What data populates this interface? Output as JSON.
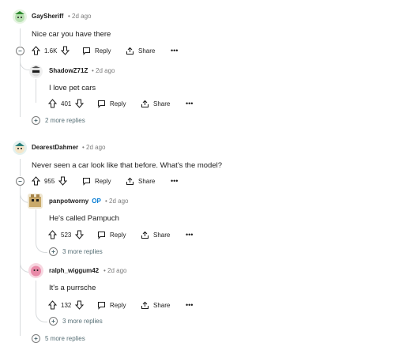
{
  "thread": {
    "comments": [
      {
        "username": "GaySheriff",
        "time": "2d ago",
        "text": "Nice car you have there",
        "votes": "1.6K",
        "reply_label": "Reply",
        "share_label": "Share",
        "replies": [
          {
            "username": "ShadowZ71Z",
            "time": "2d ago",
            "text": "I love pet cars",
            "votes": "401",
            "reply_label": "Reply",
            "share_label": "Share",
            "more_replies": "2 more replies"
          }
        ]
      },
      {
        "username": "DearestDahmer",
        "time": "2d ago",
        "text": "Never seen a car look like that before. What's the model?",
        "votes": "955",
        "reply_label": "Reply",
        "share_label": "Share",
        "more_replies": "5 more replies",
        "replies": [
          {
            "username": "panpotworny",
            "op_badge": "OP",
            "time": "2d ago",
            "text": "He's called Pampuch",
            "votes": "523",
            "reply_label": "Reply",
            "share_label": "Share",
            "more_replies": "3 more replies"
          },
          {
            "username": "ralph_wiggum42",
            "time": "2d ago",
            "text": "It's a purrsche",
            "votes": "132",
            "reply_label": "Reply",
            "share_label": "Share",
            "more_replies": "3 more replies"
          }
        ]
      }
    ]
  },
  "icons": {
    "upvote": "arrow-up-icon",
    "downvote": "arrow-down-icon",
    "reply": "speech-bubble-icon",
    "share": "share-icon",
    "more": "ellipsis-icon",
    "collapse": "minus-circle-icon",
    "expand": "plus-circle-icon"
  },
  "colors": {
    "text": "#1c1c1c",
    "meta": "#7c7c7c",
    "thread_line": "#d7dadc",
    "op": "#0079d3",
    "more_replies": "#576f76"
  }
}
